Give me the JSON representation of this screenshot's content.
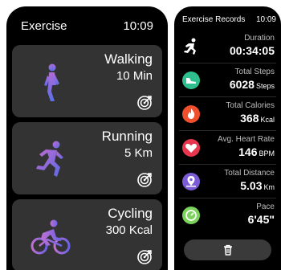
{
  "left": {
    "title": "Exercise",
    "clock": "10:09",
    "cards": [
      {
        "name": "Walking",
        "value": "10 Min",
        "icon": "walking-icon"
      },
      {
        "name": "Running",
        "value": "5 Km",
        "icon": "running-icon"
      },
      {
        "name": "Cycling",
        "value": "300 Kcal",
        "icon": "cycling-icon"
      }
    ],
    "target_icon": "target-icon",
    "accent": "#8a5cf0"
  },
  "right": {
    "title": "Exercise Records",
    "clock": "10:09",
    "records": [
      {
        "label": "Duration",
        "value": "00:34:05",
        "unit": "",
        "icon": "person-running-icon",
        "color": "#000000"
      },
      {
        "label": "Total Steps",
        "value": "6028",
        "unit": "Steps",
        "icon": "shoe-icon",
        "color": "#2fbf8e"
      },
      {
        "label": "Total Calories",
        "value": "368",
        "unit": "Kcal",
        "icon": "flame-icon",
        "color": "#f04f2e"
      },
      {
        "label": "Avg. Heart Rate",
        "value": "146",
        "unit": "BPM",
        "icon": "heart-icon",
        "color": "#e8364e"
      },
      {
        "label": "Total Distance",
        "value": "5.03",
        "unit": "Km",
        "icon": "location-icon",
        "color": "#7b5cd6"
      },
      {
        "label": "Pace",
        "value": "6'45\"",
        "unit": "",
        "icon": "speed-gauge-icon",
        "color": "#7ad35a"
      }
    ],
    "delete_icon": "trash-icon"
  }
}
